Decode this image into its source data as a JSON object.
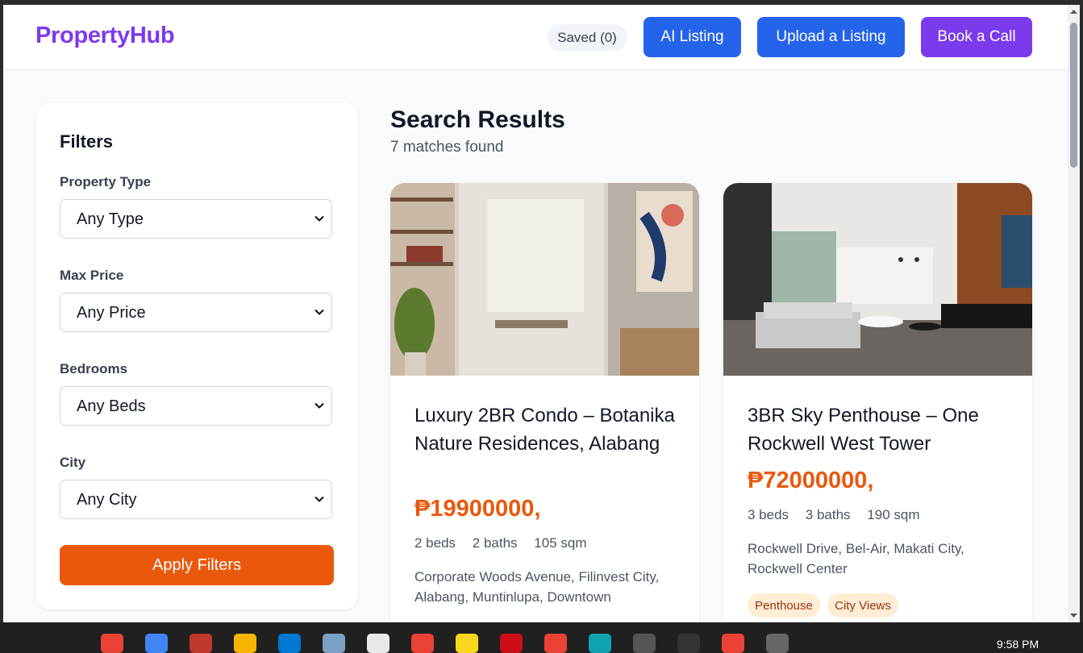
{
  "header": {
    "brand": "PropertyHub",
    "saved_label": "Saved (0)",
    "ai_listing_label": "AI Listing",
    "upload_label": "Upload a Listing",
    "book_call_label": "Book a Call"
  },
  "filters": {
    "title": "Filters",
    "property_type": {
      "label": "Property Type",
      "value": "Any Type"
    },
    "max_price": {
      "label": "Max Price",
      "value": "Any Price"
    },
    "bedrooms": {
      "label": "Bedrooms",
      "value": "Any Beds"
    },
    "city": {
      "label": "City",
      "value": "Any City"
    },
    "apply_label": "Apply Filters"
  },
  "results": {
    "title": "Search Results",
    "count_text": "7 matches found",
    "listings": [
      {
        "title": "Luxury 2BR Condo – Botanika Nature Residences, Alabang",
        "price": "₱19900000,",
        "beds": "2 beds",
        "baths": "2 baths",
        "area": "105 sqm",
        "location": "Corporate Woods Avenue, Filinvest City, Alabang, Muntinlupa, Downtown",
        "tags": []
      },
      {
        "title": "3BR Sky Penthouse – One Rockwell West Tower",
        "price": "₱72000000,",
        "beds": "3 beds",
        "baths": "3 baths",
        "area": "190 sqm",
        "location": "Rockwell Drive, Bel-Air, Makati City, Rockwell Center",
        "tags": [
          "Penthouse",
          "City Views"
        ]
      }
    ]
  },
  "taskbar": {
    "time": "9:58 PM"
  },
  "colors": {
    "brand": "#7c3aed",
    "primary": "#2563eb",
    "accent": "#ea580c"
  }
}
